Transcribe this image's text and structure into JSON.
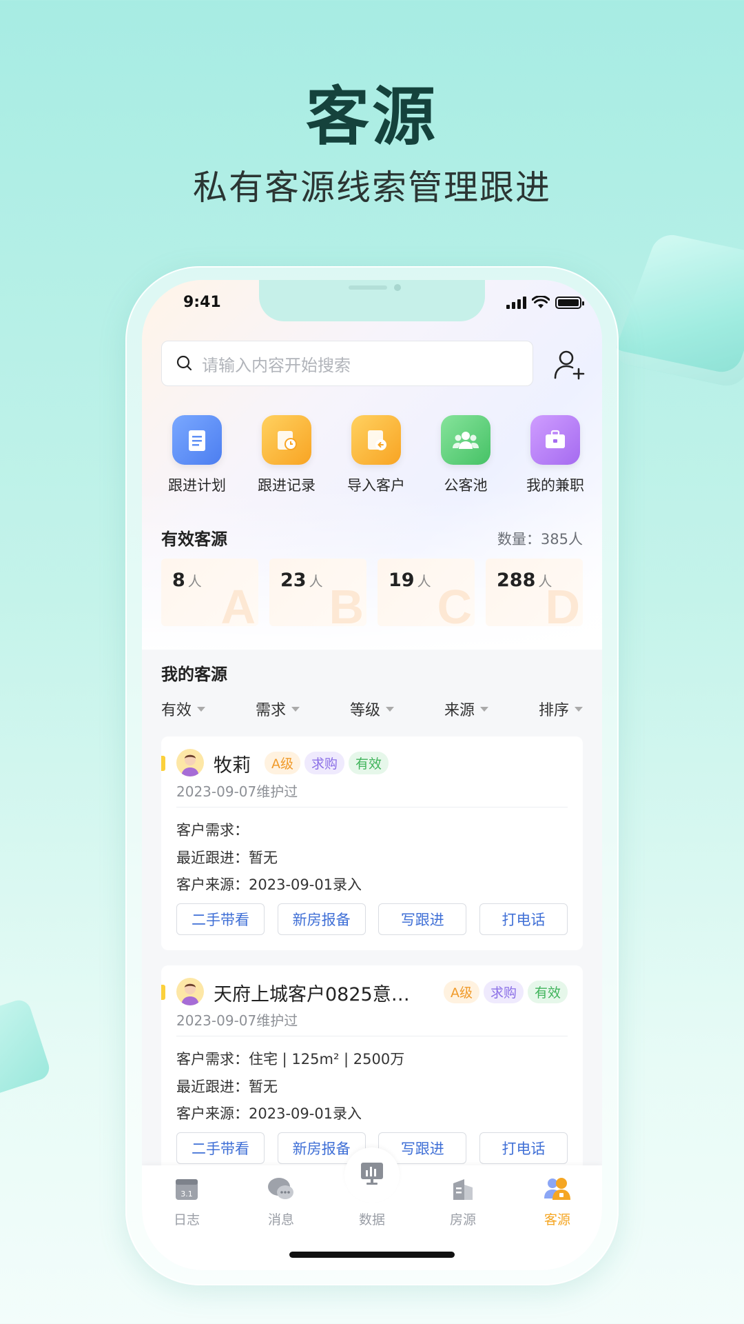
{
  "hero": {
    "title": "客源",
    "subtitle": "私有客源线索管理跟进"
  },
  "status": {
    "time": "9:41"
  },
  "search": {
    "placeholder": "请输入内容开始搜索"
  },
  "quick_actions": [
    {
      "label": "跟进计划",
      "icon": "plan-icon",
      "color": "#5f8ff5"
    },
    {
      "label": "跟进记录",
      "icon": "record-icon",
      "color": "#fbb62f"
    },
    {
      "label": "导入客户",
      "icon": "import-icon",
      "color": "#fbb62f"
    },
    {
      "label": "公客池",
      "icon": "public-pool-icon",
      "color": "#5fd07a"
    },
    {
      "label": "我的兼职",
      "icon": "briefcase-icon",
      "color": "#b07bf2"
    }
  ],
  "valid_section": {
    "title": "有效客源",
    "count_label": "数量：385人",
    "grades": [
      {
        "count": "8",
        "unit": "人",
        "letter": "A"
      },
      {
        "count": "23",
        "unit": "人",
        "letter": "B"
      },
      {
        "count": "19",
        "unit": "人",
        "letter": "C"
      },
      {
        "count": "288",
        "unit": "人",
        "letter": "D"
      }
    ]
  },
  "my_section": {
    "title": "我的客源",
    "filters": [
      "有效",
      "需求",
      "等级",
      "来源",
      "排序"
    ]
  },
  "cards": [
    {
      "name": "牧莉",
      "tags": [
        "A级",
        "求购",
        "有效"
      ],
      "date": "2023-09-07维护过",
      "demand": "客户需求：",
      "recent": "最近跟进：暂无",
      "source": "客户来源：2023-09-01录入",
      "buttons": [
        "二手带看",
        "新房报备",
        "写跟进",
        "打电话"
      ]
    },
    {
      "name": "天府上城客户0825意…",
      "tags": [
        "A级",
        "求购",
        "有效"
      ],
      "date": "2023-09-07维护过",
      "demand": "客户需求：住宅 | 125m² | 2500万",
      "recent": "最近跟进：暂无",
      "source": "客户来源：2023-09-01录入",
      "buttons": [
        "二手带看",
        "新房报备",
        "写跟进",
        "打电话"
      ]
    }
  ],
  "tabbar": [
    {
      "label": "日志",
      "icon": "calendar-icon"
    },
    {
      "label": "消息",
      "icon": "chat-icon"
    },
    {
      "label": "数据",
      "icon": "chart-board-icon"
    },
    {
      "label": "房源",
      "icon": "building-icon"
    },
    {
      "label": "客源",
      "icon": "customer-icon",
      "active": true,
      "color": "#f5a623"
    }
  ]
}
